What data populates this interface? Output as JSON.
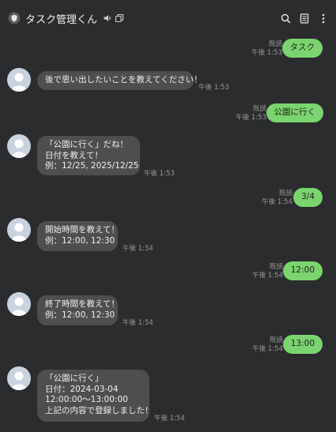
{
  "header": {
    "title": "タスク管理くん",
    "icons": [
      "shield-icon",
      "speaker-icon",
      "copy-icon",
      "search-icon",
      "note-icon",
      "more-vertical-icon"
    ]
  },
  "colors": {
    "background": "#2b2c2e",
    "incoming_bubble": "#4d4e50",
    "outgoing_bubble": "#7bd46f"
  },
  "messages": [
    {
      "dir": "out",
      "text": "タスク",
      "read": "既読",
      "time": "午後 1:53"
    },
    {
      "dir": "in",
      "text": "後で思い出したいことを教えてください！",
      "time": "午後 1:53"
    },
    {
      "dir": "out",
      "text": "公園に行く",
      "read": "既読",
      "time": "午後 1:53"
    },
    {
      "dir": "in",
      "text": "「公園に行く」だね！\n日付を教えて！\n例：12/25, 2025/12/25",
      "time": "午後 1:53"
    },
    {
      "dir": "out",
      "text": "3/4",
      "read": "既読",
      "time": "午後 1:54"
    },
    {
      "dir": "in",
      "text": "開始時間を教えて！\n例：12:00, 12:30",
      "time": "午後 1:54"
    },
    {
      "dir": "out",
      "text": "12:00",
      "read": "既読",
      "time": "午後 1:54"
    },
    {
      "dir": "in",
      "text": "終了時間を教えて！\n例：12:00, 12:30",
      "time": "午後 1:54"
    },
    {
      "dir": "out",
      "text": "13:00",
      "read": "既読",
      "time": "午後 1:54"
    },
    {
      "dir": "in",
      "text": "「公園に行く」\n日付：2024-03-04\n12:00:00〜13:00:00\n上記の内容で登録しました！",
      "time": "午後 1:54"
    }
  ]
}
